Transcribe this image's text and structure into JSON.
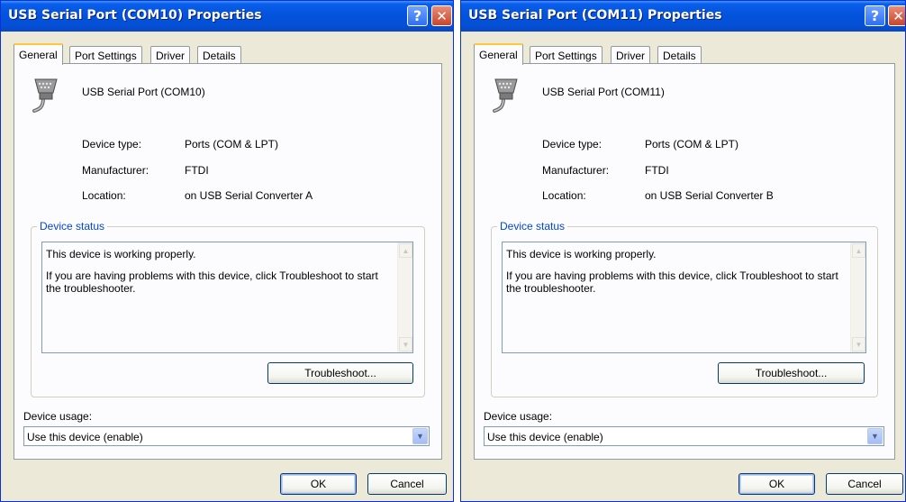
{
  "tabs": [
    "General",
    "Port Settings",
    "Driver",
    "Details"
  ],
  "common": {
    "device_type_label": "Device type:",
    "device_type_value": "Ports (COM & LPT)",
    "manufacturer_label": "Manufacturer:",
    "manufacturer_value": "FTDI",
    "location_label": "Location:",
    "device_status_title": "Device status",
    "status_line1": "This device is working properly.",
    "status_line2": "If you are having problems with this device, click Troubleshoot to start the troubleshooter.",
    "troubleshoot_label": "Troubleshoot...",
    "device_usage_label": "Device usage:",
    "device_usage_value": "Use this device (enable)",
    "ok_label": "OK",
    "cancel_label": "Cancel",
    "help_glyph": "?",
    "close_glyph": "✕"
  },
  "windows": [
    {
      "title": "USB Serial Port (COM10) Properties",
      "device_name": "USB Serial Port (COM10)",
      "location_value": "on USB Serial Converter A"
    },
    {
      "title": "USB Serial Port (COM11) Properties",
      "device_name": "USB Serial Port (COM11)",
      "location_value": "on USB Serial Converter B"
    }
  ],
  "colors": {
    "titlebar": "#0453dd",
    "dialog_bg": "#ece9d8",
    "group_title": "#0046d5",
    "tab_highlight": "#ffc83c"
  },
  "icons": {
    "help": "help-icon",
    "close": "close-icon",
    "port": "serial-port-icon",
    "dropdown": "chevron-down-icon"
  }
}
